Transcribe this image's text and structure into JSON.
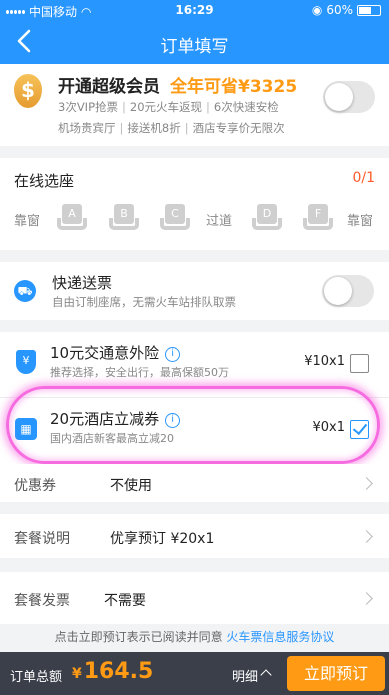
{
  "status": {
    "carrier": "中国移动",
    "time": "16:29",
    "battery": "60%"
  },
  "nav": {
    "title": "订单填写"
  },
  "vip": {
    "coin_symbol": "$",
    "title": "开通超级会员",
    "highlight": "全年可省¥3325",
    "benefits_line1": [
      "3次VIP抢票",
      "20元火车返现",
      "6次快速安检"
    ],
    "benefits_line2": [
      "机场贵宾厅",
      "接送机8折",
      "酒店专享价无限次"
    ]
  },
  "seat": {
    "title": "在线选座",
    "count": "0/1",
    "window_label": "靠窗",
    "aisle_label": "过道",
    "seats": [
      "A",
      "B",
      "C",
      "D",
      "F"
    ]
  },
  "express": {
    "title": "快递送票",
    "subtitle": "自由订制座席，无需火车站排队取票"
  },
  "insurance": {
    "title": "10元交通意外险",
    "subtitle": "推荐选择，安全出行，最高保额50万",
    "price": "¥10x1",
    "checked": false
  },
  "hotel_coupon": {
    "title": "20元酒店立减券",
    "subtitle": "国内酒店新客最高立减20",
    "price": "¥0x1",
    "checked": true
  },
  "coupon_row": {
    "label": "优惠券",
    "value": "不使用"
  },
  "package_row": {
    "label": "套餐说明",
    "value": "优享预订 ¥20x1"
  },
  "invoice_row": {
    "label": "套餐发票",
    "value": "不需要"
  },
  "notice": {
    "text": "点击立即预订表示已阅读并同意",
    "link": "火车票信息服务协议"
  },
  "bottom": {
    "total_label": "订单总额",
    "currency": "¥",
    "total": "164.5",
    "detail": "明细",
    "submit": "立即预订"
  },
  "colors": {
    "brand": "#2896ff",
    "accent": "#ff9a14",
    "alert": "#ff5a2b",
    "annotation": "#f66ce0"
  }
}
